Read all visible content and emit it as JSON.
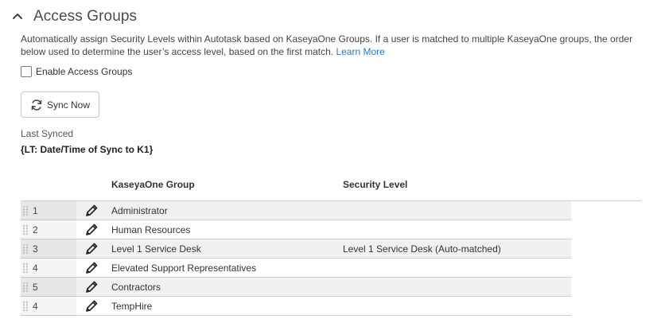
{
  "section": {
    "title": "Access Groups",
    "description": "Automatically assign Security Levels within Autotask based on KaseyaOne Groups. If a user is matched to multiple KaseyaOne groups, the order below used to determine the user’s access level, based on the first match.",
    "learn_more": "Learn More"
  },
  "enable": {
    "label": "Enable Access Groups",
    "checked": false
  },
  "sync": {
    "button_label": "Sync Now",
    "last_synced_label": "Last Synced",
    "last_synced_value": "{LT: Date/Time of Sync to K1}"
  },
  "table": {
    "headers": {
      "group": "KaseyaOne Group",
      "level": "Security Level"
    },
    "rows": [
      {
        "num": "1",
        "group": "Administrator",
        "level": ""
      },
      {
        "num": "2",
        "group": "Human Resources",
        "level": ""
      },
      {
        "num": "3",
        "group": "Level 1 Service Desk",
        "level": "Level 1 Service Desk (Auto-matched)"
      },
      {
        "num": "4",
        "group": "Elevated Support Representatives",
        "level": ""
      },
      {
        "num": "5",
        "group": "Contractors",
        "level": ""
      },
      {
        "num": "4",
        "group": "TempHire",
        "level": ""
      }
    ]
  },
  "icons": {
    "collapse": "chevron-up-icon",
    "sync": "refresh-icon",
    "edit": "pencil-icon",
    "drag": "drag-handle-icon"
  },
  "colors": {
    "link": "#2b7bbf",
    "text": "#333333",
    "row_alt": "#f0f0f0"
  }
}
